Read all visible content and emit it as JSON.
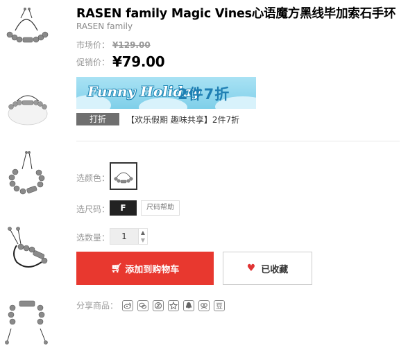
{
  "product": {
    "title": "RASEN family Magic Vines心语魔方黑线毕加索石手环",
    "brand": "RASEN family"
  },
  "price": {
    "market_label": "市场价：",
    "market_value": "¥129.00",
    "promo_label": "促销价：",
    "promo_value": "¥79.00"
  },
  "banner": {
    "line1": "Funny Holiday",
    "line2": "2件7折"
  },
  "discount": {
    "tag": "打折",
    "text": "【欢乐假期 趣味共享】2件7折"
  },
  "options": {
    "color_label": "选颜色：",
    "size_label": "选尺码：",
    "size_value": "F",
    "size_help": "尺码帮助",
    "qty_label": "选数量：",
    "qty_value": "1",
    "qty_up_icon": "▲",
    "qty_down_icon": "▼"
  },
  "actions": {
    "add_to_cart": "添加到购物车",
    "cart_icon": "cart-icon",
    "favorited": "已收藏",
    "heart_icon": "heart-icon"
  },
  "share": {
    "label": "分享商品：",
    "icons": [
      "weibo-icon",
      "wechat-icon",
      "qzone-icon",
      "favorite-star-icon",
      "qq-icon",
      "renren-icon",
      "douban-icon"
    ],
    "douban_glyph": "豆"
  },
  "colors": {
    "accent_red": "#e8382f",
    "banner_blue": "#8ed7ef",
    "tag_gray": "#6f6f6f"
  }
}
